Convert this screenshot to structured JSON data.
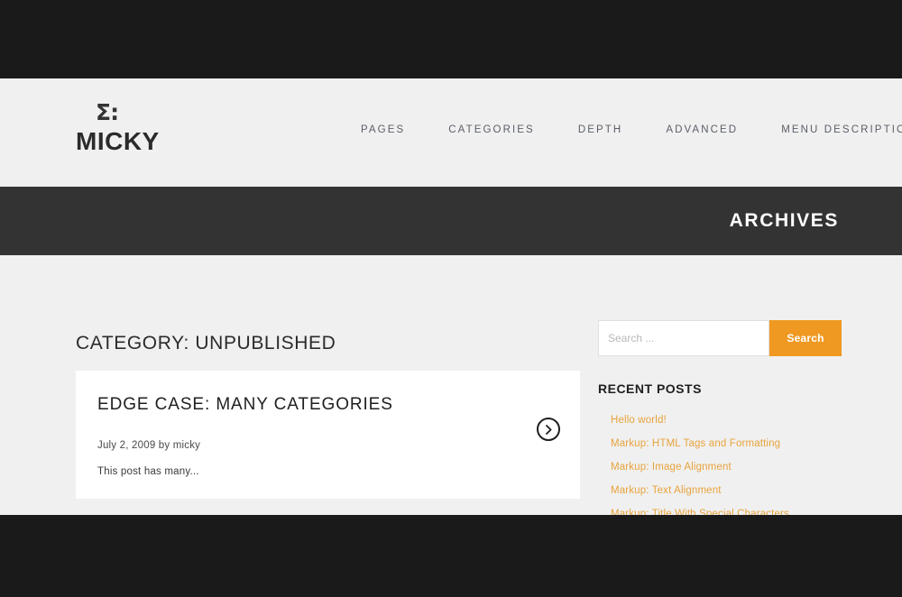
{
  "header": {
    "logo_mark": "Σ:",
    "logo_name": "MICKY",
    "nav": [
      {
        "label": "PAGES"
      },
      {
        "label": "CATEGORIES"
      },
      {
        "label": "DEPTH"
      },
      {
        "label": "ADVANCED"
      },
      {
        "label": "MENU DESCRIPTION"
      }
    ]
  },
  "banner": {
    "title": "ARCHIVES"
  },
  "main": {
    "category_heading": "CATEGORY: UNPUBLISHED",
    "post": {
      "title": "EDGE CASE: MANY CATEGORIES",
      "meta": "July 2, 2009 by micky",
      "excerpt": "This post has many...",
      "read_more_icon": "chevron-right-circle-icon"
    }
  },
  "sidebar": {
    "search": {
      "placeholder": "Search ...",
      "value": "",
      "button_label": "Search"
    },
    "recent_posts": {
      "title": "RECENT POSTS",
      "items": [
        {
          "label": "Hello world!"
        },
        {
          "label": "Markup: HTML Tags and Formatting"
        },
        {
          "label": "Markup: Image Alignment"
        },
        {
          "label": "Markup: Text Alignment"
        },
        {
          "label": "Markup: Title With Special Characters"
        }
      ]
    }
  },
  "colors": {
    "accent_orange": "#ef9922",
    "link_orange": "#e8a33d",
    "dark_bar": "#1a1a1a",
    "banner_bar": "#333333",
    "page_bg": "#f0f0f0",
    "card_bg": "#ffffff"
  }
}
